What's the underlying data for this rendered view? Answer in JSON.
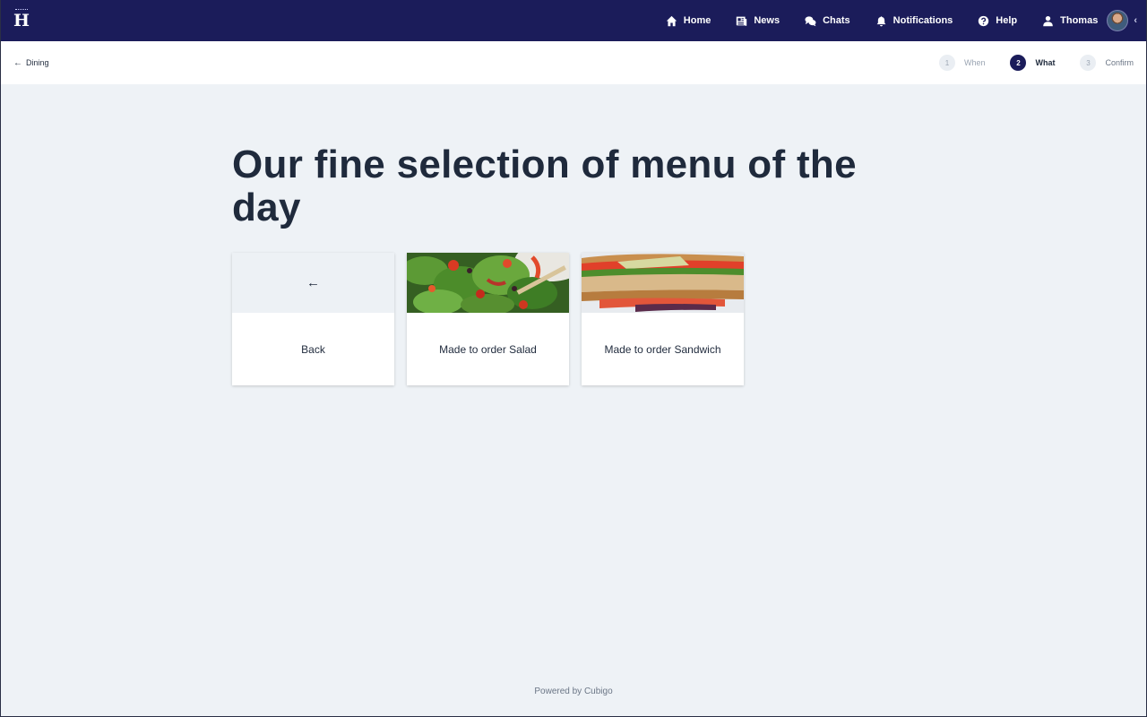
{
  "nav": {
    "logo_letter": "H",
    "items": [
      {
        "label": "Home",
        "icon": "home-icon"
      },
      {
        "label": "News",
        "icon": "news-icon"
      },
      {
        "label": "Chats",
        "icon": "chat-icon"
      },
      {
        "label": "Notifications",
        "icon": "bell-icon"
      },
      {
        "label": "Help",
        "icon": "help-icon"
      },
      {
        "label": "Thomas",
        "icon": "user-icon"
      }
    ],
    "bg_color": "#1b1c5a"
  },
  "subbar": {
    "back_label": "Dining",
    "steps": [
      {
        "num": "1",
        "label": "When"
      },
      {
        "num": "2",
        "label": "What"
      },
      {
        "num": "3",
        "label": "Confirm"
      }
    ],
    "active_step": 2
  },
  "main": {
    "title": "Our fine selection of menu of the day",
    "cards": [
      {
        "label": "Back",
        "image": "arrow-left-icon"
      },
      {
        "label": "Made to order Salad",
        "image": "salad-photo"
      },
      {
        "label": "Made to order Sandwich",
        "image": "sandwich-photo"
      }
    ]
  },
  "footer": {
    "text": "Powered by Cubigo"
  }
}
